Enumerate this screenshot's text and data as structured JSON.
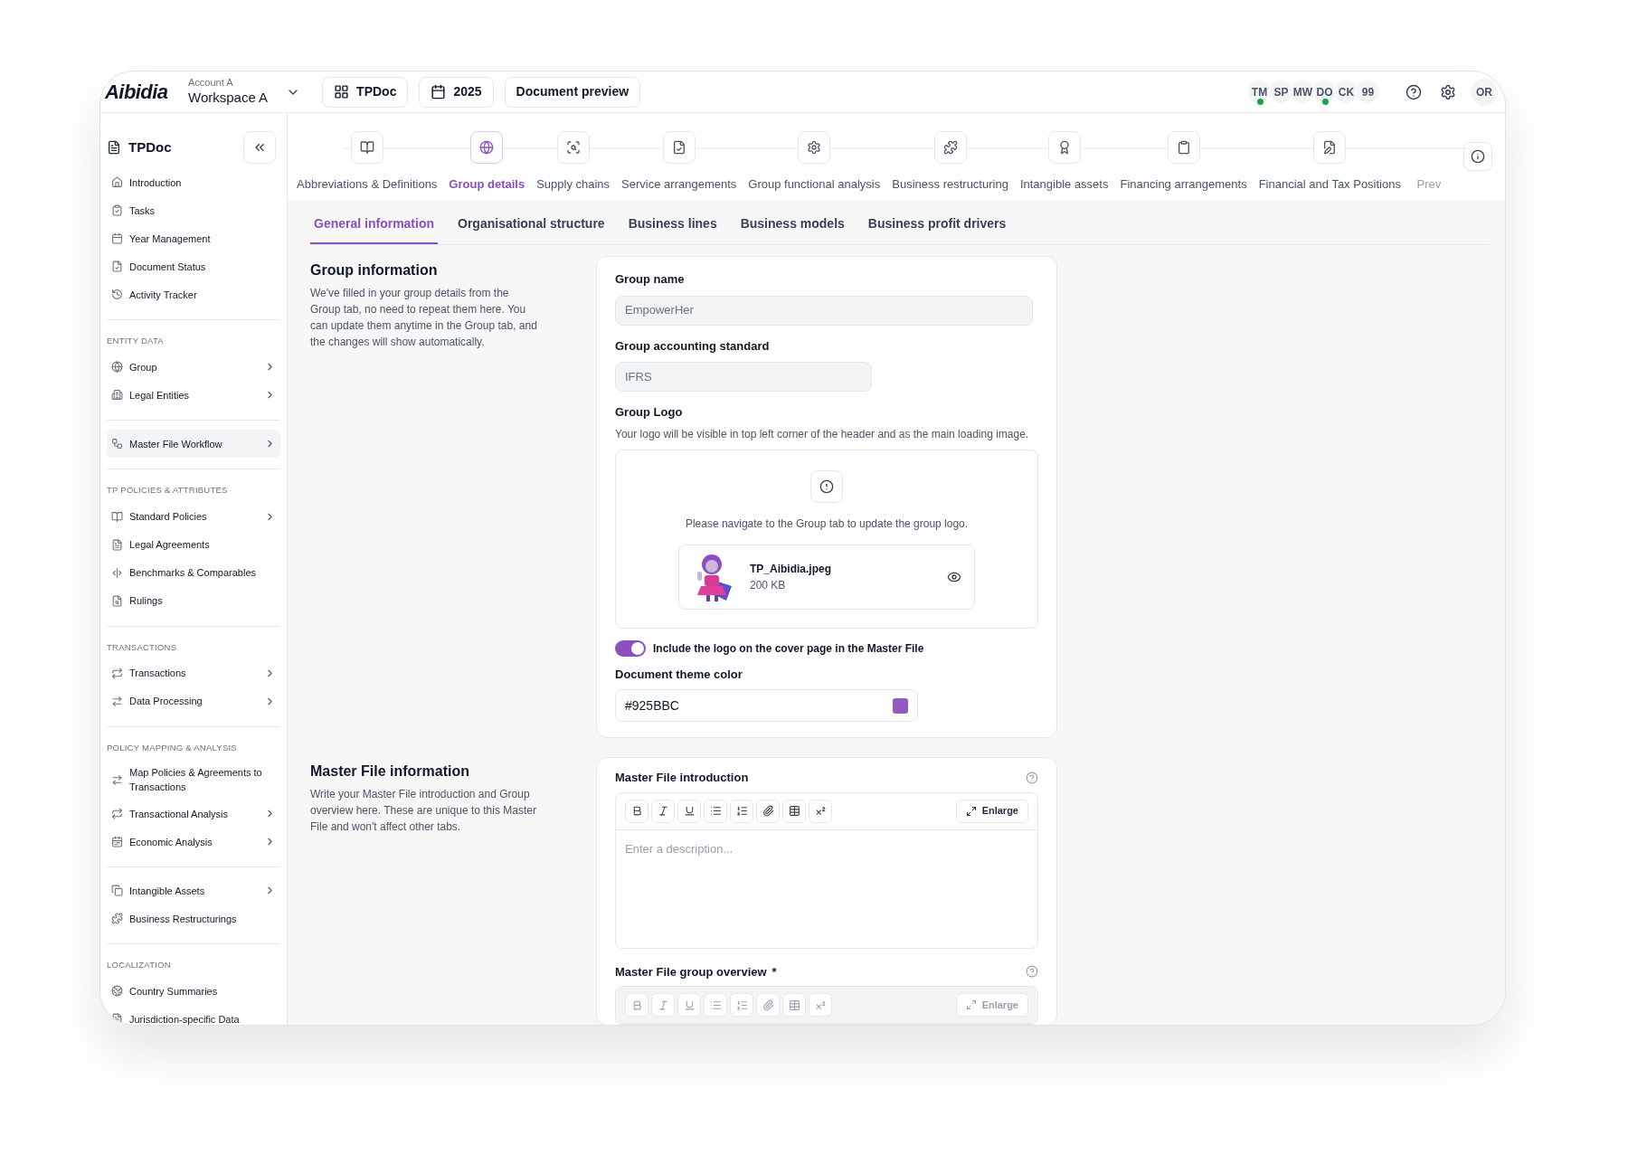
{
  "header": {
    "logo": "Aibidia",
    "account": "Account A",
    "workspace": "Workspace A",
    "buttons": [
      {
        "kind": "grid",
        "label": "TPDoc"
      },
      {
        "kind": "calendar",
        "label": "2025"
      },
      {
        "kind": "plain",
        "label": "Document preview"
      }
    ],
    "avatars": [
      {
        "initials": "TM",
        "online": true
      },
      {
        "initials": "SP",
        "online": false
      },
      {
        "initials": "MW",
        "online": false
      },
      {
        "initials": "DO",
        "online": true
      },
      {
        "initials": "CK",
        "online": false
      },
      {
        "initials": "99",
        "online": false
      }
    ],
    "user": "OR"
  },
  "sidebar": {
    "title": "TPDoc",
    "sections": [
      {
        "items": [
          {
            "label": "Introduction",
            "chevron": false,
            "selected": false
          },
          {
            "label": "Tasks",
            "chevron": false,
            "selected": false
          },
          {
            "label": "Year Management",
            "chevron": false,
            "selected": false
          },
          {
            "label": "Document Status",
            "chevron": false,
            "selected": false
          },
          {
            "label": "Activity Tracker",
            "chevron": false,
            "selected": false
          }
        ]
      },
      {
        "heading": "ENTITY DATA",
        "items": [
          {
            "label": "Group",
            "chevron": true,
            "selected": false
          },
          {
            "label": "Legal Entities",
            "chevron": true,
            "selected": false
          }
        ]
      },
      {
        "items": [
          {
            "label": "Master File Workflow",
            "chevron": true,
            "selected": true
          }
        ]
      },
      {
        "heading": "TP POLICIES & ATTRIBUTES",
        "items": [
          {
            "label": "Standard Policies",
            "chevron": true,
            "selected": false
          },
          {
            "label": "Legal Agreements",
            "chevron": false,
            "selected": false
          },
          {
            "label": "Benchmarks & Comparables",
            "chevron": false,
            "selected": false
          },
          {
            "label": "Rulings",
            "chevron": false,
            "selected": false
          }
        ]
      },
      {
        "heading": "TRANSACTIONS",
        "items": [
          {
            "label": "Transactions",
            "chevron": true,
            "selected": false
          },
          {
            "label": "Data Processing",
            "chevron": true,
            "selected": false
          }
        ]
      },
      {
        "heading": "POLICY MAPPING & ANALYSIS",
        "items": [
          {
            "label": "Map Policies & Agreements to Transactions",
            "chevron": false,
            "selected": false
          },
          {
            "label": "Transactional Analysis",
            "chevron": true,
            "selected": false
          },
          {
            "label": "Economic Analysis",
            "chevron": true,
            "selected": false
          }
        ]
      },
      {
        "items": [
          {
            "label": "Intangible Assets",
            "chevron": true,
            "selected": false
          },
          {
            "label": "Business Restructurings",
            "chevron": false,
            "selected": false
          }
        ]
      },
      {
        "heading": "LOCALIZATION",
        "items": [
          {
            "label": "Country Summaries",
            "chevron": false,
            "selected": false
          },
          {
            "label": "Jurisdiction-specific Data",
            "chevron": false,
            "selected": false
          }
        ]
      }
    ]
  },
  "steps": [
    {
      "label": "Abbreviations & Definitions",
      "selected": false
    },
    {
      "label": "Group details",
      "selected": true
    },
    {
      "label": "Supply chains",
      "selected": false
    },
    {
      "label": "Service arrangements",
      "selected": false
    },
    {
      "label": "Group functional analysis",
      "selected": false
    },
    {
      "label": "Business restructuring",
      "selected": false
    },
    {
      "label": "Intangible assets",
      "selected": false
    },
    {
      "label": "Financing arrangements",
      "selected": false
    },
    {
      "label": "Financial and Tax Positions",
      "selected": false
    },
    {
      "label": "Prev",
      "selected": false
    }
  ],
  "tabs": [
    {
      "label": "General information",
      "selected": true
    },
    {
      "label": "Organisational structure",
      "selected": false
    },
    {
      "label": "Business lines",
      "selected": false
    },
    {
      "label": "Business models",
      "selected": false
    },
    {
      "label": "Business profit drivers",
      "selected": false
    }
  ],
  "group_information": {
    "title": "Group information",
    "description": "We've filled in your group details from the Group tab, no need to repeat them here. You can update them anytime in the Group tab, and the changes will show automatically.",
    "group_name": {
      "label": "Group name",
      "value": "EmpowerHer"
    },
    "accounting_standard": {
      "label": "Group accounting standard",
      "value": "IFRS"
    },
    "logo": {
      "label": "Group Logo",
      "hint": "Your logo will be visible in top left corner of the header and as the main loading image.",
      "notice": "Please navigate to the Group tab to update the group logo.",
      "file_name": "TP_Aibidia.jpeg",
      "file_size": "200 KB"
    },
    "include_logo": {
      "label": "Include the logo on the cover page in the Master File",
      "on": true
    },
    "theme_color": {
      "label": "Document theme color",
      "value": "#925BBC"
    }
  },
  "master_file_information": {
    "title": "Master File information",
    "description": "Write your Master File introduction and Group overview here. These are unique to this Master File and won't affect other tabs.",
    "editors": [
      {
        "label": "Master File introduction",
        "disabled": false,
        "placeholder": "Enter a description...",
        "enlarge": "Enlarge"
      },
      {
        "label": "Master File group overview",
        "required_mark": "*",
        "disabled": true,
        "enlarge": "Enlarge"
      }
    ]
  }
}
